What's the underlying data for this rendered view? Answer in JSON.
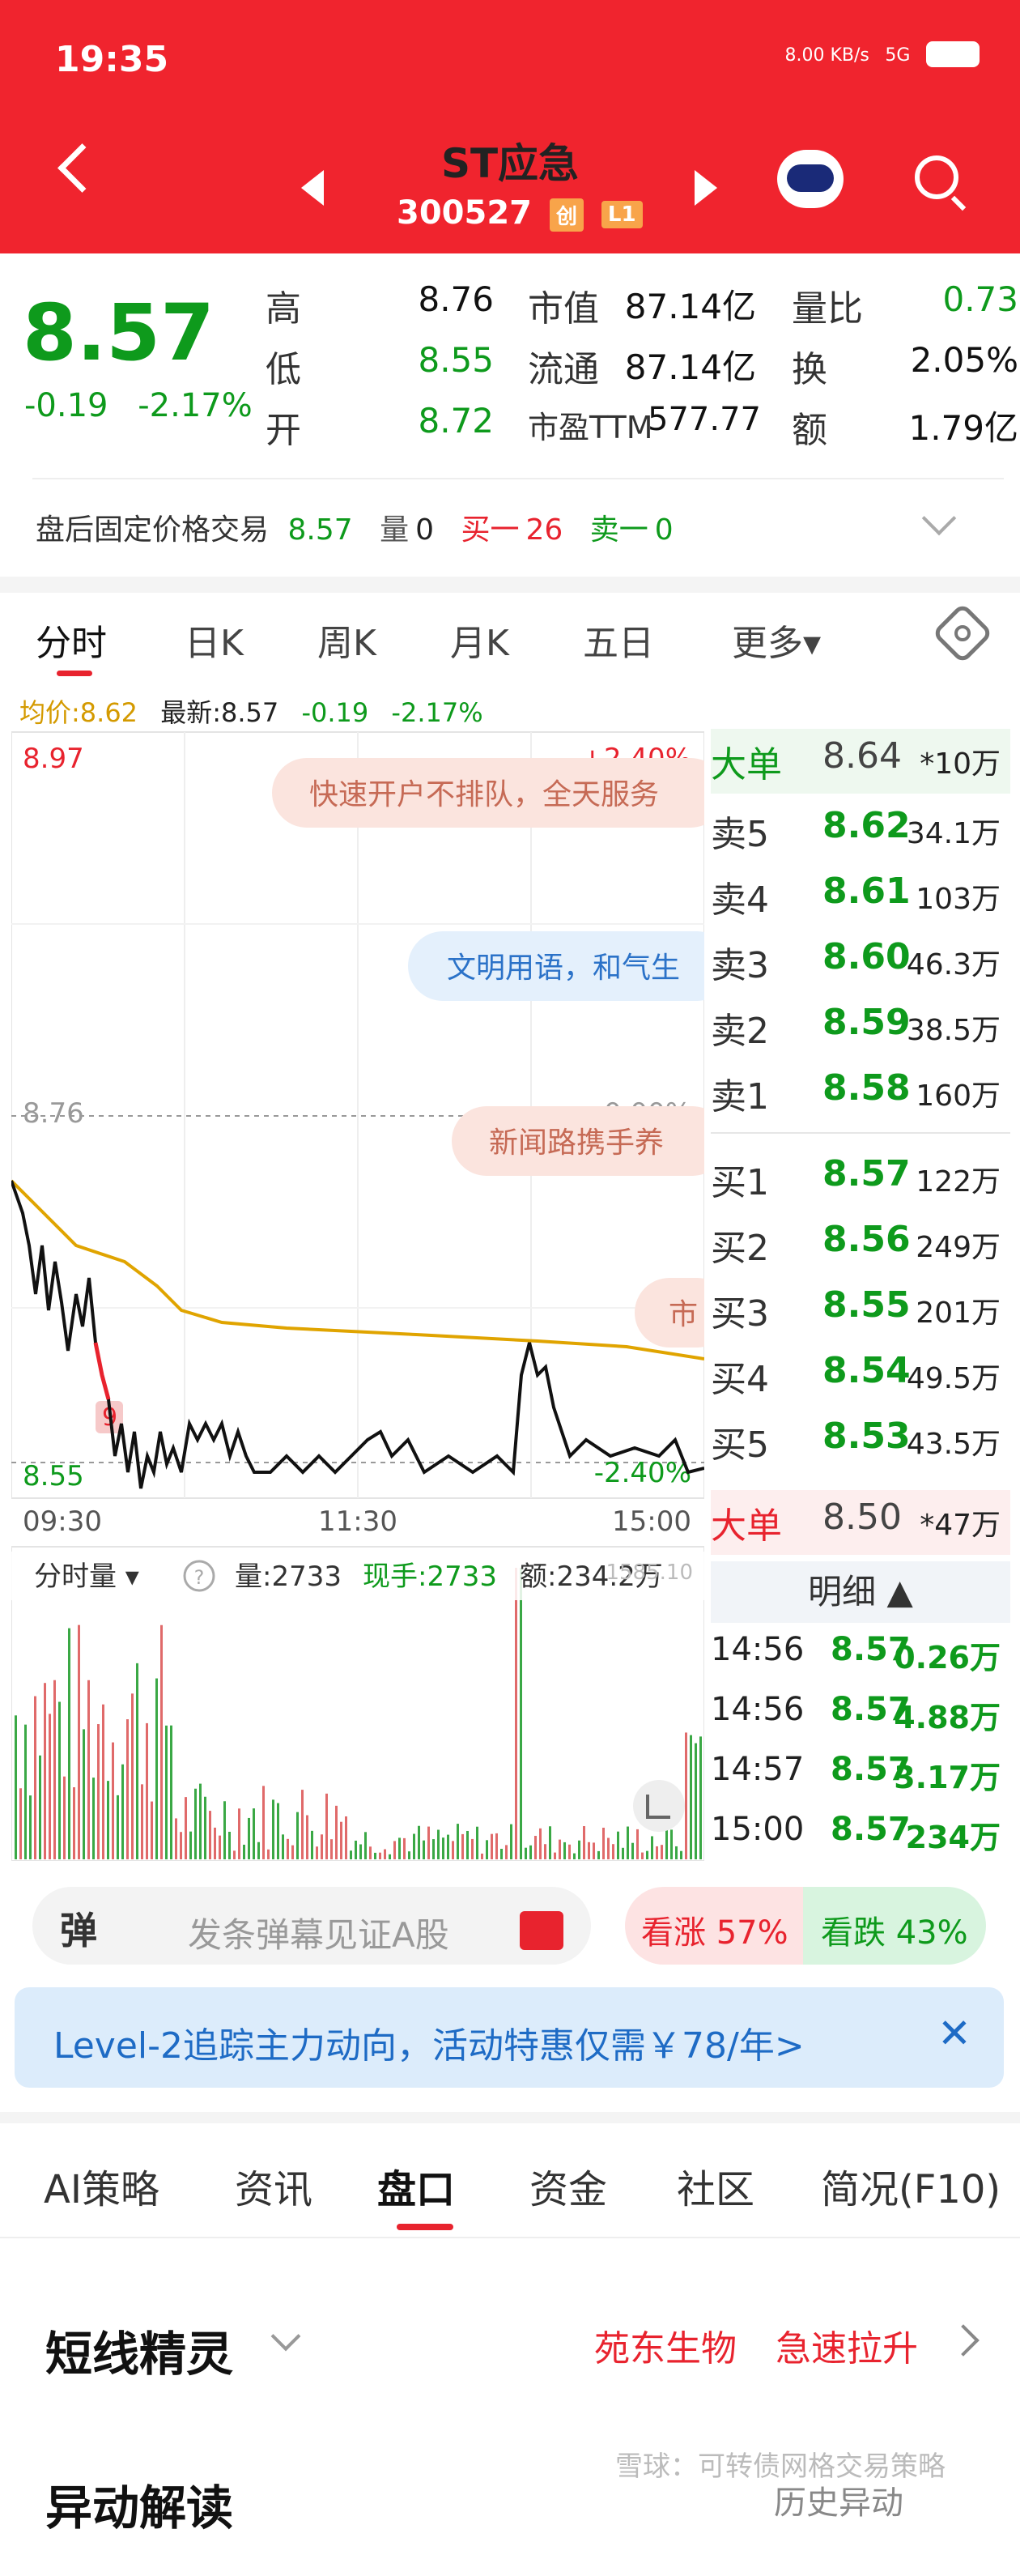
{
  "status_bar": {
    "time": "19:35",
    "network": "8.00 KB/s",
    "signal": "5G"
  },
  "header": {
    "title": "ST应急",
    "code": "300527",
    "tag1": "创",
    "tag2": "L1"
  },
  "quote": {
    "price": "8.57",
    "change": "-0.19",
    "change_pct": "-2.17%",
    "rows": [
      {
        "l1": "高",
        "v1": "8.76",
        "l2": "市值",
        "v2": "87.14亿",
        "l3": "量比",
        "v3": "0.73"
      },
      {
        "l1": "低",
        "v1": "8.55",
        "l2": "流通",
        "v2": "87.14亿",
        "l3": "换",
        "v3": "2.05%"
      },
      {
        "l1": "开",
        "v1": "8.72",
        "l2": "市盈TTM",
        "v2": "577.77",
        "l3": "额",
        "v3": "1.79亿"
      }
    ]
  },
  "after_hours": {
    "label": "盘后固定价格交易",
    "price": "8.57",
    "vol_label": "量",
    "vol": "0",
    "buy_label": "买一",
    "buy": "26",
    "sell_label": "卖一",
    "sell": "0"
  },
  "ktabs": [
    "分时",
    "日K",
    "周K",
    "月K",
    "五日",
    "更多▾"
  ],
  "legend": {
    "avg": "均价:8.62",
    "last": "最新:8.57",
    "chg": "-0.19",
    "pct": "-2.17%"
  },
  "chart_labels": {
    "hi": "8.97",
    "mid": "8.76",
    "lo": "8.55",
    "hi_pct": "+2.40%",
    "mid_pct": "0.00%",
    "lo_pct": "-2.40%",
    "t_start": "09:30",
    "t_mid": "11:30",
    "t_end": "15:00",
    "marker": "9"
  },
  "bullets": [
    "快速开户不排队，全天服务",
    "文明用语，和气生",
    "新闻路携手养",
    "市"
  ],
  "order_book": {
    "top": {
      "label": "大单",
      "price": "8.64",
      "vol": "*10万"
    },
    "asks": [
      {
        "label": "卖5",
        "price": "8.62",
        "vol": "34.1万"
      },
      {
        "label": "卖4",
        "price": "8.61",
        "vol": "103万"
      },
      {
        "label": "卖3",
        "price": "8.60",
        "vol": "46.3万"
      },
      {
        "label": "卖2",
        "price": "8.59",
        "vol": "38.5万"
      },
      {
        "label": "卖1",
        "price": "8.58",
        "vol": "160万"
      }
    ],
    "bids": [
      {
        "label": "买1",
        "price": "8.57",
        "vol": "122万"
      },
      {
        "label": "买2",
        "price": "8.56",
        "vol": "249万"
      },
      {
        "label": "买3",
        "price": "8.55",
        "vol": "201万"
      },
      {
        "label": "买4",
        "price": "8.54",
        "vol": "49.5万"
      },
      {
        "label": "买5",
        "price": "8.53",
        "vol": "43.5万"
      }
    ],
    "bottom": {
      "label": "大单",
      "price": "8.50",
      "vol": "*47万"
    }
  },
  "detail": {
    "title": "明细 ▲",
    "rows": [
      {
        "time": "14:56",
        "price": "8.57",
        "vol": "0.26万"
      },
      {
        "time": "14:56",
        "price": "8.57",
        "vol": "4.88万"
      },
      {
        "time": "14:57",
        "price": "8.57",
        "vol": "3.17万"
      },
      {
        "time": "15:00",
        "price": "8.57",
        "vol": "234万"
      }
    ]
  },
  "volume_panel": {
    "label": "分时量 ▾",
    "help": "?",
    "vol": "量:2733",
    "now": "现手:2733",
    "amount": "额:234.2万",
    "max": "1585.10"
  },
  "danmu": {
    "icon": "弹",
    "placeholder": "发条弹幕见证A股",
    "bull": "看涨 57%",
    "bear": "看跌 43%"
  },
  "banner": {
    "text": "Level-2追踪主力动向，活动特惠仅需￥78/年>",
    "close": "✕"
  },
  "bottom_tabs": [
    "AI策略",
    "资讯",
    "盘口",
    "资金",
    "社区",
    "简况(F10)"
  ],
  "sprite": {
    "title": "短线精灵",
    "stock": "苑东生物",
    "signal": "急速拉升"
  },
  "bottom": {
    "title": "异动解读",
    "right": "历史异动",
    "watermark": "雪球：可转债网格交易策略"
  },
  "colors": {
    "header": "#f0242e",
    "up": "#e8232e",
    "down": "#0e9a1c",
    "avg_line": "#e0a400"
  }
}
